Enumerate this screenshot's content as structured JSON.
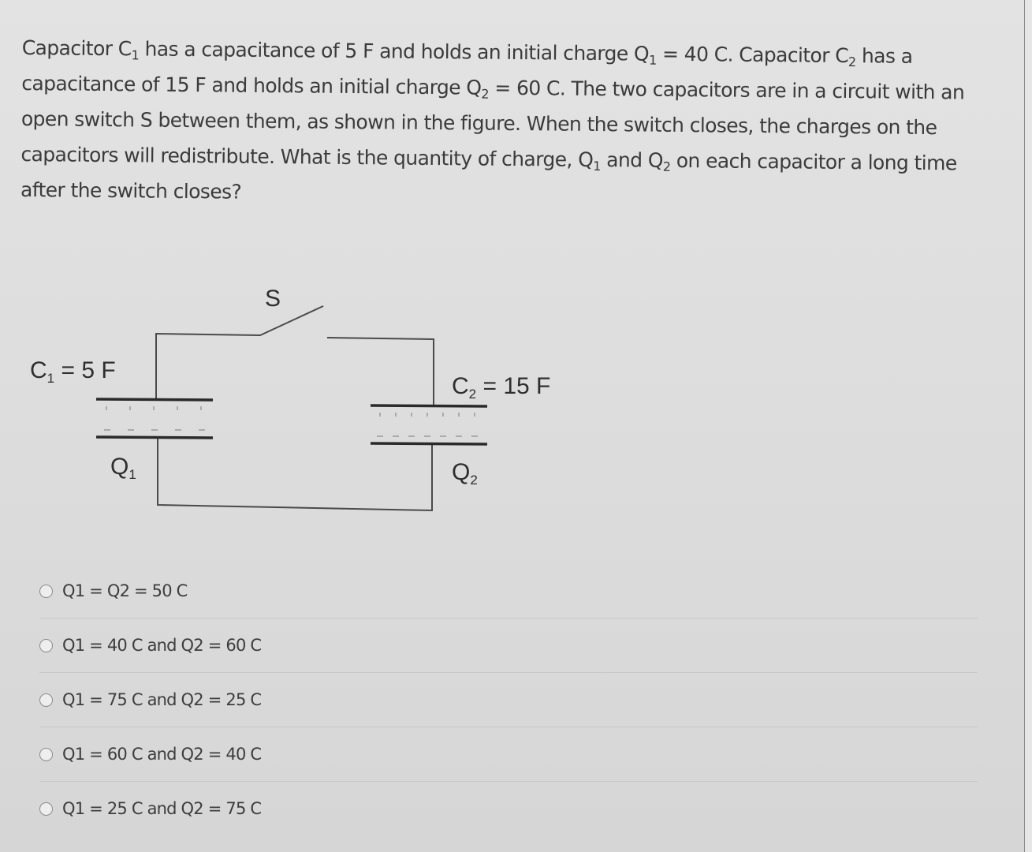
{
  "question": {
    "parts": [
      "Capacitor C",
      "1",
      " has a capacitance of 5 F and holds an initial charge Q",
      "1",
      " = 40 C. Capacitor C",
      "2",
      " has a capacitance of 15 F and holds an initial charge Q",
      "2",
      " = 60 C.  The two capacitors are in a circuit with an open switch S between them, as shown in the figure.  When the switch closes, the charges on the capacitors will redistribute.  What is the quantity of charge, Q",
      "1",
      " and Q",
      "2",
      " on each capacitor a long time after the switch closes?"
    ]
  },
  "figure": {
    "switch_label": "S",
    "c1_label_main": "C",
    "c1_label_sub": "1",
    "c1_label_value": " = 5 F",
    "q1_label_main": "Q",
    "q1_label_sub": "1",
    "c2_label_main": "C",
    "c2_label_sub": "2",
    "c2_label_value": " = 15 F",
    "q2_label_main": "Q",
    "q2_label_sub": "2"
  },
  "options": [
    {
      "label": "Q1 = Q2 = 50 C",
      "selected": false
    },
    {
      "label": "Q1 = 40 C and Q2 = 60 C",
      "selected": false
    },
    {
      "label": "Q1 = 75 C and Q2 = 25 C",
      "selected": false
    },
    {
      "label": "Q1 = 60 C and Q2 = 40 C",
      "selected": false
    },
    {
      "label": "Q1 = 25 C and Q2 = 75 C",
      "selected": false
    }
  ]
}
